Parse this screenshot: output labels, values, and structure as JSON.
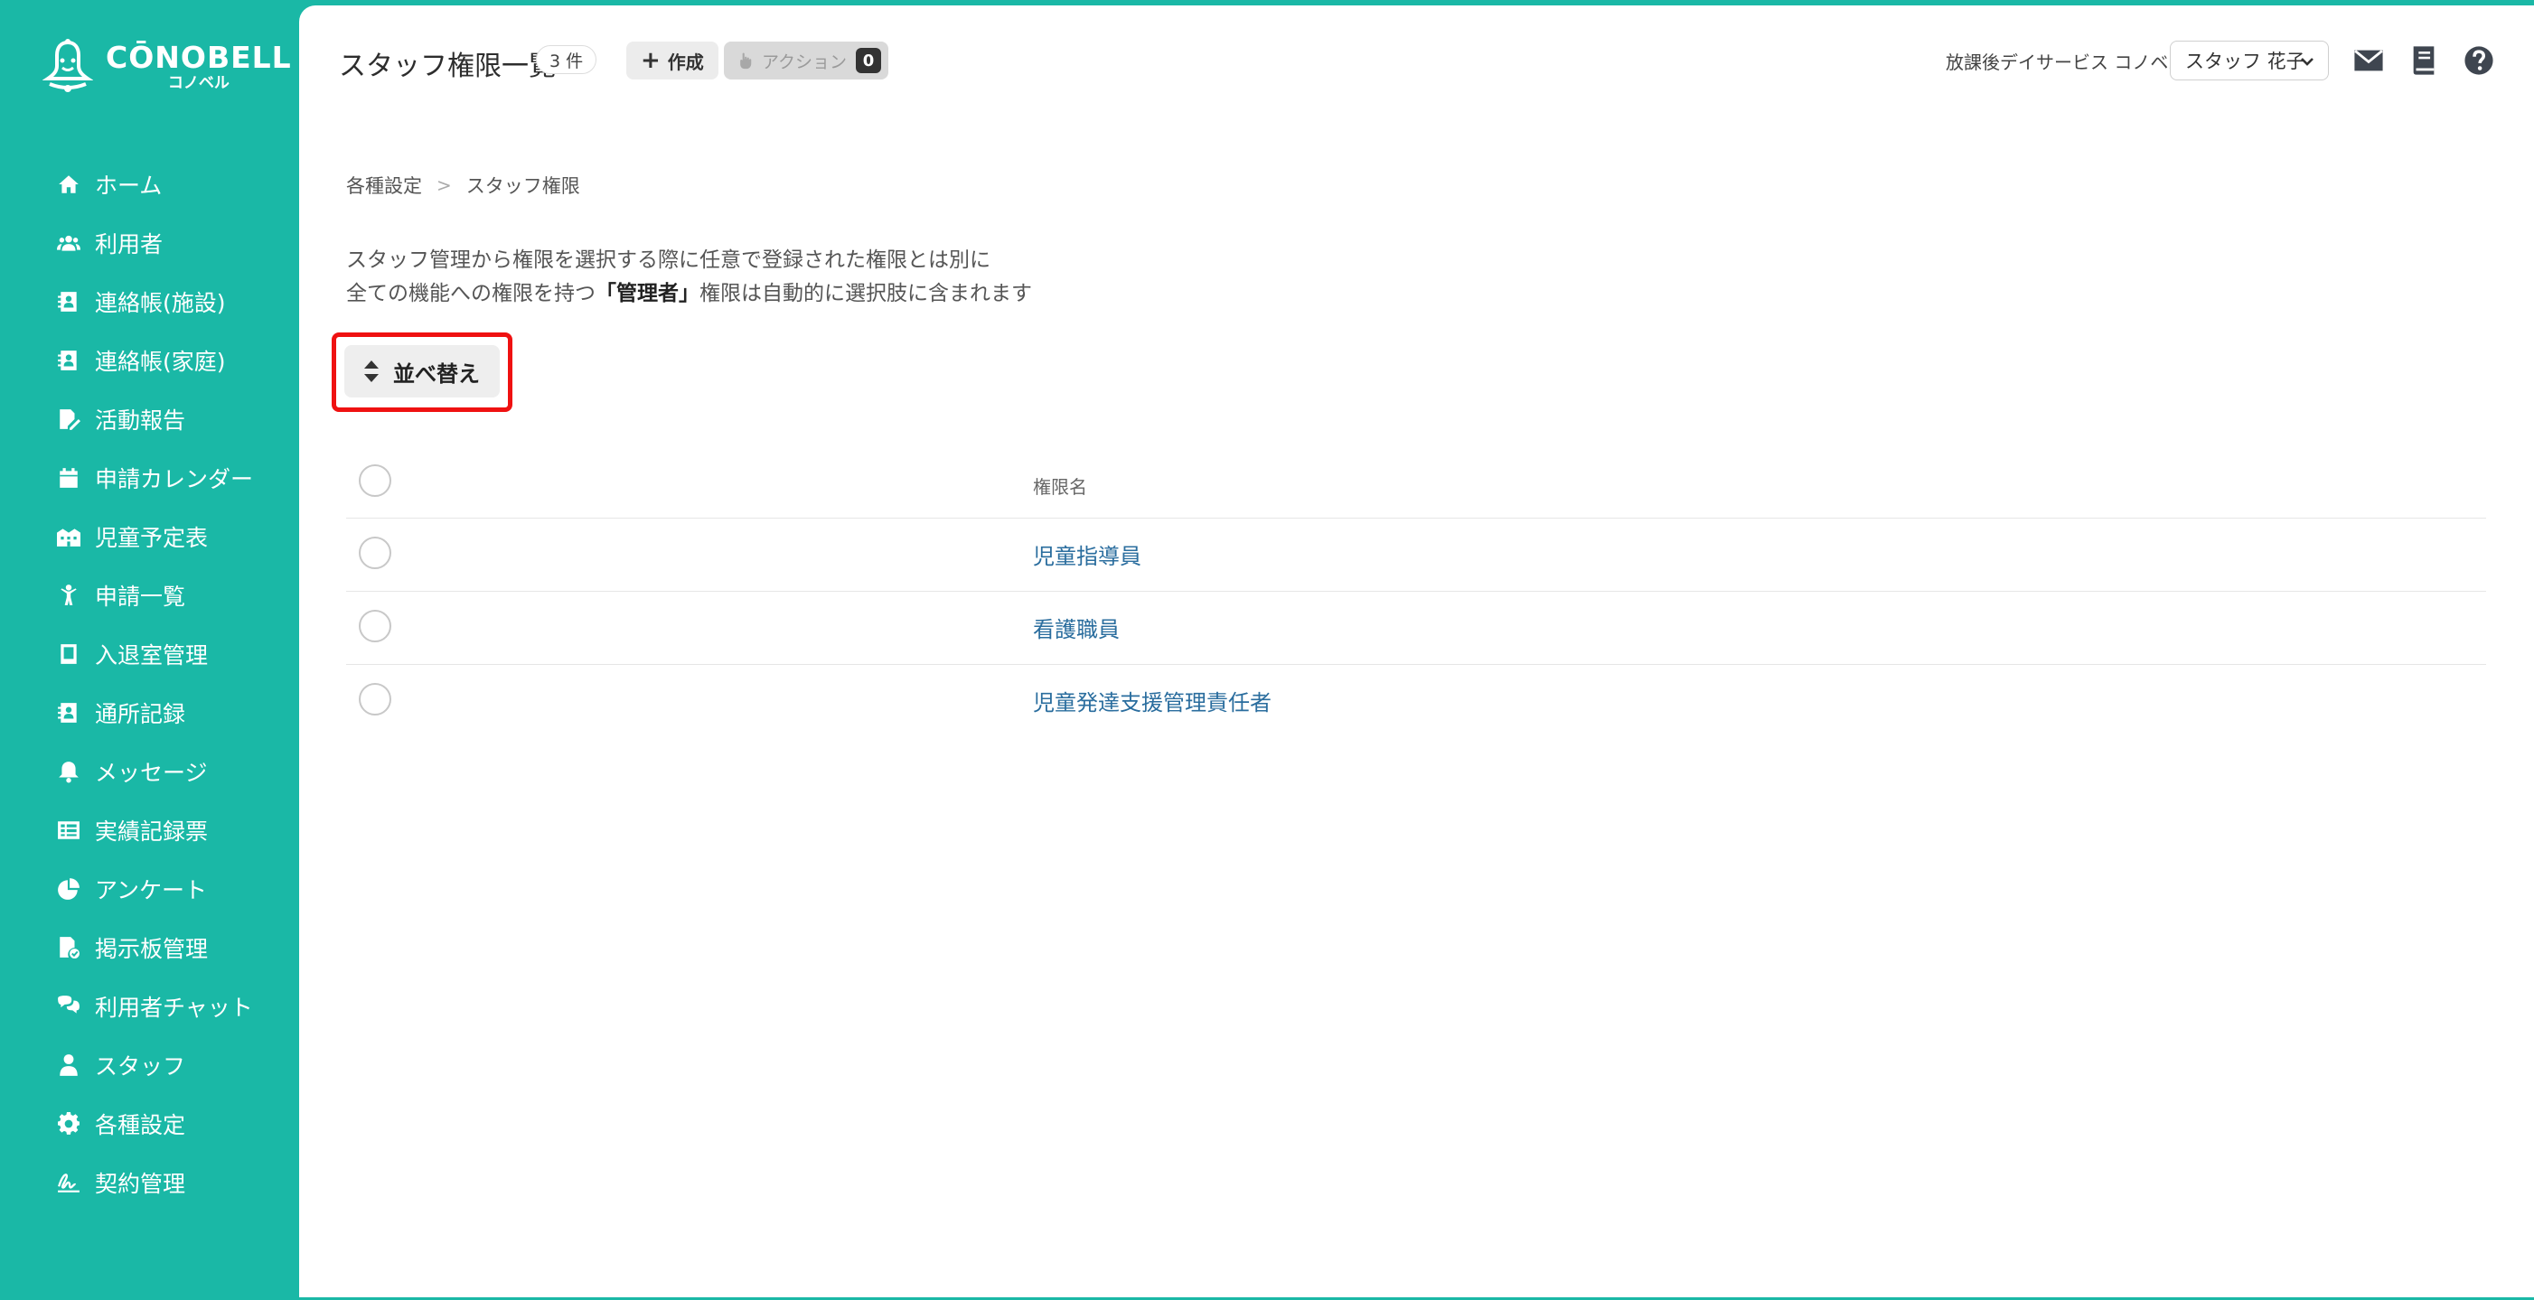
{
  "brand": {
    "name": "CŌNOBELL",
    "sub": "コノベル"
  },
  "sidebar": {
    "items": [
      {
        "label": "ホーム",
        "icon": "home-icon"
      },
      {
        "label": "利用者",
        "icon": "users-icon"
      },
      {
        "label": "連絡帳(施設)",
        "icon": "contact-book-icon"
      },
      {
        "label": "連絡帳(家庭)",
        "icon": "contact-book-icon"
      },
      {
        "label": "活動報告",
        "icon": "edit-document-icon"
      },
      {
        "label": "申請カレンダー",
        "icon": "calendar-icon"
      },
      {
        "label": "児童予定表",
        "icon": "schedule-icon"
      },
      {
        "label": "申請一覧",
        "icon": "child-icon"
      },
      {
        "label": "入退室管理",
        "icon": "tablet-icon"
      },
      {
        "label": "通所記録",
        "icon": "contact-book-icon"
      },
      {
        "label": "メッセージ",
        "icon": "bell-icon"
      },
      {
        "label": "実績記録票",
        "icon": "table-icon"
      },
      {
        "label": "アンケート",
        "icon": "pie-chart-icon"
      },
      {
        "label": "掲示板管理",
        "icon": "board-icon"
      },
      {
        "label": "利用者チャット",
        "icon": "chat-icon"
      },
      {
        "label": "スタッフ",
        "icon": "staff-icon"
      },
      {
        "label": "各種設定",
        "icon": "gear-icon"
      },
      {
        "label": "契約管理",
        "icon": "signature-icon"
      }
    ]
  },
  "header": {
    "title": "スタッフ権限一覧",
    "count": "3 件",
    "create_label": "作成",
    "action_label": "アクション",
    "action_count": "0",
    "facility": "放課後デイサービス コノベル",
    "staff_name": "スタッフ 花子"
  },
  "breadcrumb": {
    "parent": "各種設定",
    "current": "スタッフ権限"
  },
  "description": {
    "line1": "スタッフ管理から権限を選択する際に任意で登録された権限とは別に",
    "line2_pre": "全ての機能への権限を持つ",
    "line2_bold": "「管理者」",
    "line2_post": "権限は自動的に選択肢に含まれます"
  },
  "sort_button": "並べ替え",
  "table": {
    "header": "権限名",
    "rows": [
      {
        "name": "児童指導員"
      },
      {
        "name": "看護職員"
      },
      {
        "name": "児童発達支援管理責任者"
      }
    ]
  },
  "colors": {
    "sidebar": "#1ab8a6",
    "link": "#2a6d9e",
    "highlight": "#ef1111"
  }
}
